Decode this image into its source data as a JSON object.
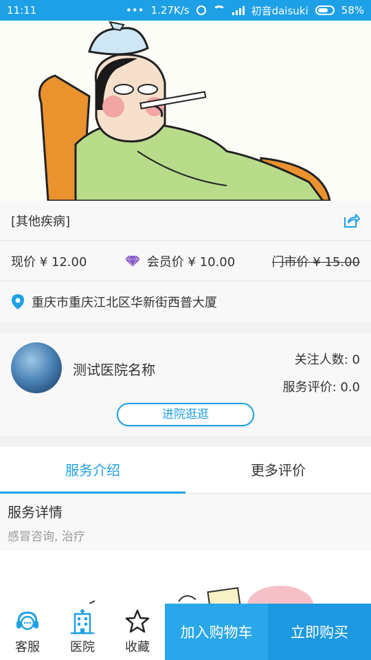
{
  "status_bar": {
    "time": "11:11",
    "speed": "1.27K/s",
    "carrier": "初音daisuki",
    "battery": "58%"
  },
  "product": {
    "title": "[其他疾病]",
    "current_price": "现价 ¥ 12.00",
    "member_price": "会员价 ¥ 10.00",
    "store_price": "门市价 ¥ 15.00",
    "address": "重庆市重庆江北区华新街西普大厦"
  },
  "hospital": {
    "name": "测试医院名称",
    "followers": "关注人数: 0",
    "rating": "服务评价: 0.0",
    "enter_label": "进院逛逛"
  },
  "tabs": [
    {
      "label": "服务介绍",
      "active": true
    },
    {
      "label": "更多评价",
      "active": false
    }
  ],
  "detail": {
    "heading": "服务详情",
    "text": "感冒咨询, 治疗"
  },
  "bottom_nav": {
    "service": "客服",
    "hospital": "医院",
    "favorite": "收藏",
    "add_cart": "加入购物车",
    "buy_now": "立即购买"
  },
  "colors": {
    "accent": "#1ea0e6",
    "member": "#8a5cc8"
  },
  "icons": [
    "headset-icon",
    "hospital-icon",
    "star-icon",
    "share-icon",
    "location-pin-icon",
    "diamond-icon"
  ]
}
